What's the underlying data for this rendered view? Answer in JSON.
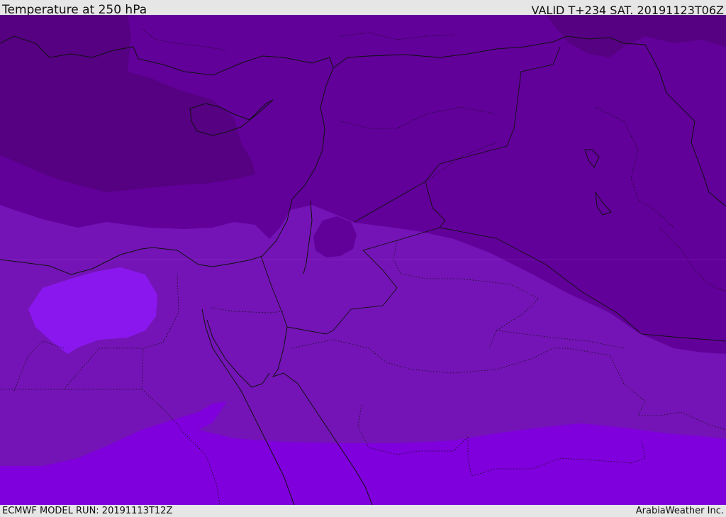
{
  "header": {
    "title": "Temperature at 250 hPa",
    "valid": "VALID T+234 SAT. 20191123T06Z"
  },
  "footer": {
    "model_run": "ECMWF MODEL RUN: 20191113T12Z",
    "credit": "ArabiaWeather Inc."
  },
  "map": {
    "variable": "temperature",
    "level": "250 hPa",
    "colors": {
      "coldest": "#560082",
      "cold": "#62009a",
      "mid_cold": "#6a05a6",
      "mid": "#7414b6",
      "warm": "#7f00dc",
      "warm_pocket": "#8a18ee",
      "coast": "#111111",
      "border": "#111111"
    }
  }
}
